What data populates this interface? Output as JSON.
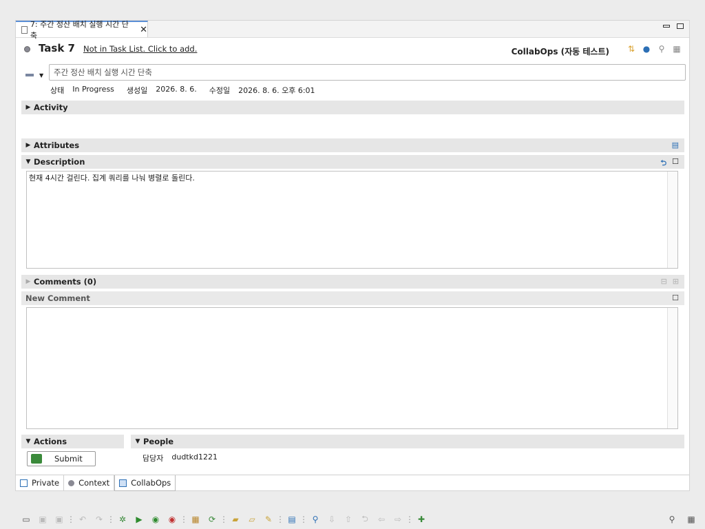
{
  "tab": {
    "label": "7: 주간 정산 배치 실행 시간 단축"
  },
  "header": {
    "task_title": "Task 7",
    "task_list_link": "Not in Task List. Click to add.",
    "repository": "CollabOps (자동 테스트)"
  },
  "summary": {
    "value": "주간 정산 배치 실행 시간 단축"
  },
  "meta": {
    "status_label": "상태",
    "status_value": "In Progress",
    "created_label": "생성일",
    "created_value": "2026. 8. 6.",
    "modified_label": "수정일",
    "modified_value": "2026. 8. 6. 오후 6:01"
  },
  "sections": {
    "activity": "Activity",
    "attributes": "Attributes",
    "description": "Description",
    "comments": "Comments (0)",
    "new_comment": "New Comment",
    "actions": "Actions",
    "people": "People"
  },
  "description": {
    "text": "현재 4시간 걸린다. 집계 쿼리를 나눠 병렬로 돌린다."
  },
  "actions": {
    "submit_label": "Submit"
  },
  "people": {
    "assignee_label": "담당자",
    "assignee_value": "dudtkd1221"
  },
  "bottom_tabs": [
    {
      "label": "Private"
    },
    {
      "label": "Context"
    },
    {
      "label": "CollabOps"
    }
  ],
  "colors": {
    "accent": "#5b8fd6",
    "section_bg": "#e6e6e6",
    "submit_icon": "#3a8a3a"
  }
}
